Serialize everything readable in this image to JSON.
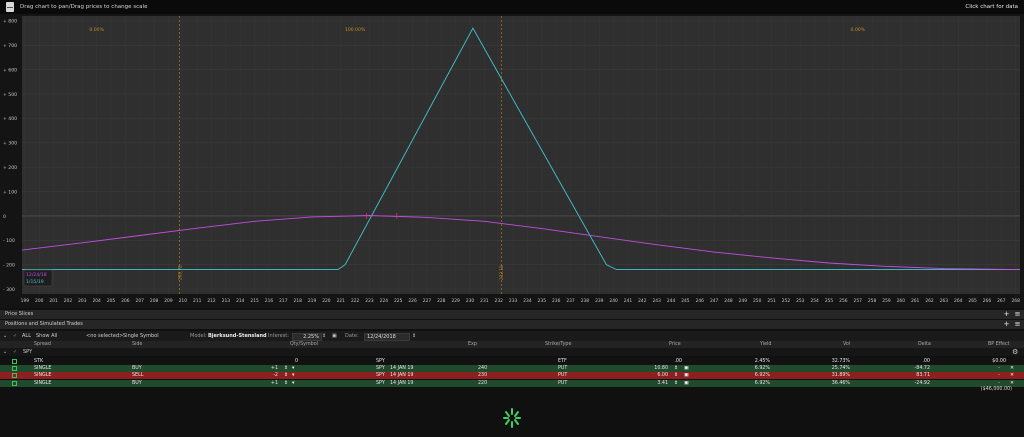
{
  "window": {
    "hint": "Drag chart to pan/Drag prices to change scale",
    "data_link": "Click chart for data"
  },
  "chart_data": {
    "type": "line",
    "x_ticks": [
      199,
      200,
      201,
      202,
      203,
      204,
      205,
      206,
      207,
      208,
      209,
      210,
      211,
      212,
      213,
      214,
      215,
      216,
      217,
      218,
      219,
      220,
      221,
      222,
      223,
      224,
      225,
      226,
      227,
      228,
      229,
      230,
      231,
      232,
      233,
      234,
      235,
      236,
      237,
      238,
      239,
      240,
      241,
      242,
      243,
      244,
      245,
      246,
      247,
      248,
      249,
      250,
      251,
      252,
      253,
      254,
      255,
      256,
      257,
      258,
      259,
      260,
      261,
      262,
      263,
      264,
      265,
      266,
      267,
      268
    ],
    "y_ticks": [
      800,
      700,
      600,
      500,
      400,
      300,
      200,
      100,
      0,
      -100,
      -200,
      -300
    ],
    "y_tick_labels": [
      "+ 800",
      "+ 700",
      "+ 600",
      "+ 500",
      "+ 400",
      "+ 300",
      "+ 200",
      "+ 100",
      "0",
      "- 100",
      "- 200",
      "- 300"
    ],
    "xlim": [
      198.8,
      268.3
    ],
    "ylim": [
      -320,
      820
    ],
    "grid": true,
    "zone_labels": [
      {
        "x": 204,
        "text": "0.00%"
      },
      {
        "x": 222,
        "text": "100.00%"
      },
      {
        "x": 257,
        "text": "0.00%"
      }
    ],
    "breakevens": [
      {
        "x": 209.78,
        "text": "209.78"
      },
      {
        "x": 232.18,
        "text": "232.18"
      }
    ],
    "series": [
      {
        "name": "1/15/19",
        "color": "#3ec7d2",
        "points": [
          [
            198.8,
            -220
          ],
          [
            220.8,
            -220
          ],
          [
            221.3,
            -200
          ],
          [
            230.2,
            770
          ],
          [
            239.5,
            -200
          ],
          [
            240.2,
            -220
          ],
          [
            268.3,
            -220
          ]
        ]
      },
      {
        "name": "12/24/18",
        "color": "#c24ee0",
        "points": [
          [
            198.8,
            -140
          ],
          [
            203,
            -110
          ],
          [
            207,
            -80
          ],
          [
            211,
            -50
          ],
          [
            215,
            -22
          ],
          [
            219,
            -4
          ],
          [
            223,
            2
          ],
          [
            227,
            -6
          ],
          [
            231,
            -22
          ],
          [
            235,
            -52
          ],
          [
            239,
            -85
          ],
          [
            243,
            -118
          ],
          [
            247,
            -148
          ],
          [
            251,
            -172
          ],
          [
            255,
            -193
          ],
          [
            259,
            -207
          ],
          [
            263,
            -216
          ],
          [
            268.3,
            -220
          ]
        ]
      }
    ],
    "markers": [
      {
        "x": 222.8,
        "color": "#e0307a"
      },
      {
        "x": 224.9,
        "color": "#e0307a"
      }
    ]
  },
  "panels": {
    "price_slices": "Price Slices",
    "positions": "Positions and Simulated Trades"
  },
  "toolbar": {
    "all": "ALL",
    "show_all": "Show All",
    "no_selected": "<no selected>",
    "single_symbol": "Single Symbol",
    "model_label": "Model:",
    "model_value": "Bjerksund-Stensland",
    "interest_label": "Interest:",
    "interest_value": "2.25%",
    "date_label": "Date:",
    "date_value": "12/24/2018"
  },
  "columns": {
    "spread": "Spread",
    "side": "Side",
    "qty_symbol": "Qty/Symbol",
    "exp": "Exp",
    "strike_type": "Strike/Type",
    "price": "Price",
    "yield": "Yield",
    "vol": "Vol",
    "delta": "Delta",
    "bp_effect": "BP Effect"
  },
  "group": {
    "symbol": "SPY"
  },
  "rows": [
    {
      "spread": "STK",
      "side": "",
      "qty": "0",
      "symbol": "SPY",
      "exp": "",
      "strike": "",
      "type": "ETF",
      "price": ".00",
      "yield": "2.45%",
      "vol": "32.73%",
      "delta": ".00",
      "bp": "$0.00"
    },
    {
      "spread": "SINGLE",
      "side": "BUY",
      "qty": "+1",
      "symbol": "SPY",
      "exp": "14 JAN 19",
      "strike": "240",
      "type": "PUT",
      "price": "10.80",
      "yield": "6.92%",
      "vol": "25.74%",
      "delta": "-84.72",
      "bp": "-"
    },
    {
      "spread": "SINGLE",
      "side": "SELL",
      "qty": "-2",
      "symbol": "SPY",
      "exp": "14 JAN 19",
      "strike": "230",
      "type": "PUT",
      "price": "6.00",
      "yield": "6.92%",
      "vol": "31.89%",
      "delta": "83.71",
      "bp": "-"
    },
    {
      "spread": "SINGLE",
      "side": "BUY",
      "qty": "+1",
      "symbol": "SPY",
      "exp": "14 JAN 19",
      "strike": "220",
      "type": "PUT",
      "price": "3.41",
      "yield": "6.92%",
      "vol": "36.46%",
      "delta": "-24.92",
      "bp": "-"
    }
  ],
  "total": "($46,000.00)"
}
